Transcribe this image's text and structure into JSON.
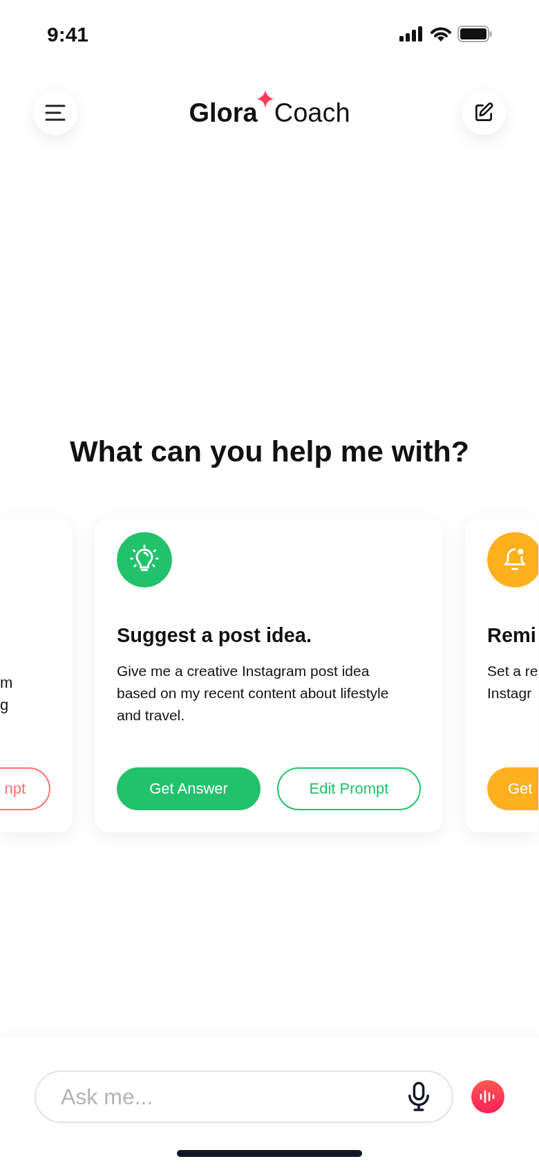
{
  "status_bar": {
    "time": "9:41"
  },
  "header": {
    "title_bold": "Glora",
    "title_light": "Coach"
  },
  "heading": "What can you help me with?",
  "cards": [
    {
      "kind": "clipped_left",
      "color": "#ff7070",
      "body_lines": [
        "m",
        "g"
      ],
      "buttons": [
        {
          "label": "npt",
          "kind": "outline"
        }
      ]
    },
    {
      "kind": "full",
      "color": "#22c16b",
      "title": "Suggest a post idea.",
      "body": "Give me a creative Instagram post idea based on my recent content about lifestyle and travel.",
      "buttons": [
        {
          "label": "Get Answer",
          "kind": "filled"
        },
        {
          "label": "Edit Prompt",
          "kind": "outline"
        }
      ]
    },
    {
      "kind": "clipped_right",
      "color": "#ffb01f",
      "title": "Remi",
      "body_lines": [
        "Set a re",
        "Instagr"
      ],
      "buttons": [
        {
          "label": "Get",
          "kind": "filled"
        }
      ]
    }
  ],
  "input": {
    "placeholder": "Ask me..."
  }
}
